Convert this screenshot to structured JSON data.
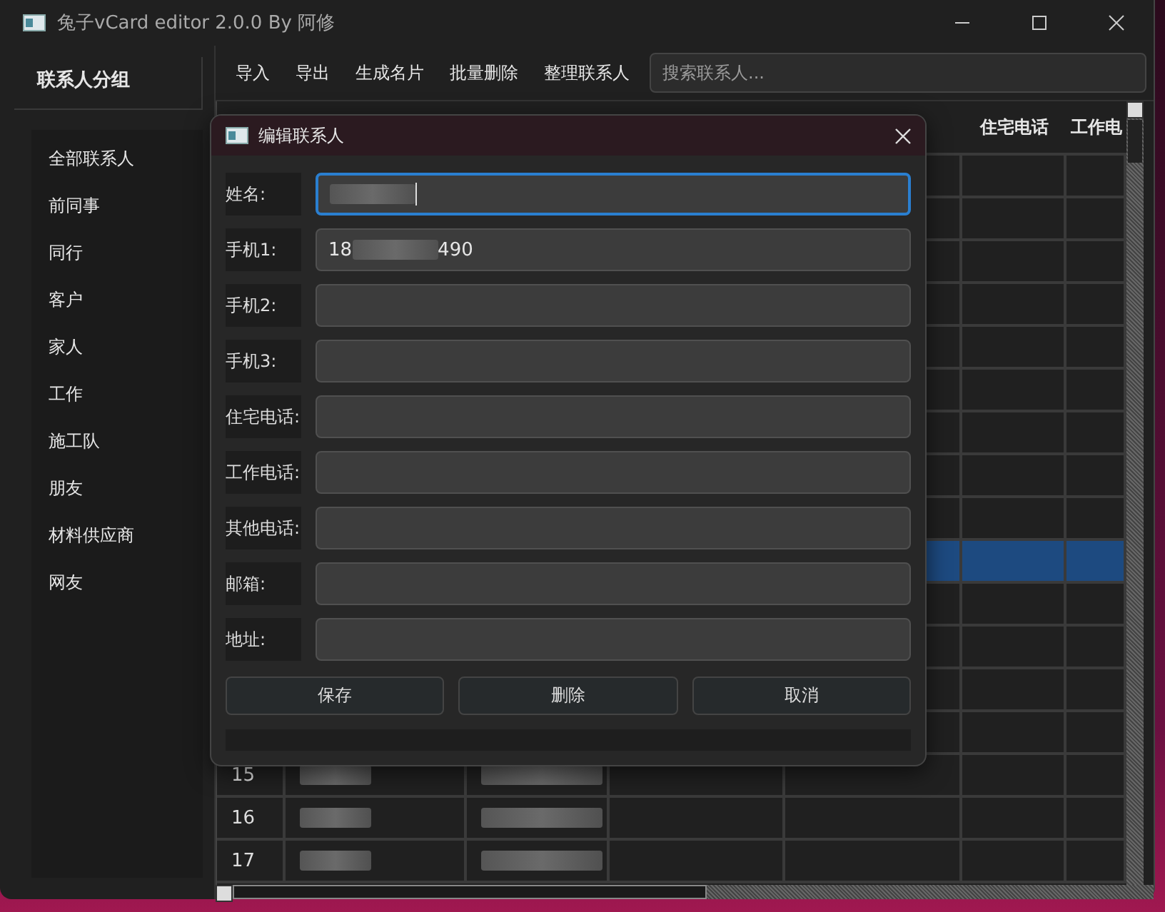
{
  "window": {
    "title": "兔子vCard editor 2.0.0 By 阿修"
  },
  "sidebar": {
    "title": "联系人分组",
    "items": [
      {
        "label": "全部联系人",
        "selected": false
      },
      {
        "label": "前同事",
        "selected": false
      },
      {
        "label": "同行",
        "selected": false
      },
      {
        "label": "客户",
        "selected": false
      },
      {
        "label": "家人",
        "selected": false
      },
      {
        "label": "工作",
        "selected": false
      },
      {
        "label": "施工队",
        "selected": false
      },
      {
        "label": "朋友",
        "selected": false
      },
      {
        "label": "材料供应商",
        "selected": false
      },
      {
        "label": "网友",
        "selected": false
      }
    ]
  },
  "toolbar": {
    "buttons": [
      "导入",
      "导出",
      "生成名片",
      "批量删除",
      "整理联系人"
    ],
    "search": {
      "placeholder": "搜索联系人..."
    }
  },
  "table": {
    "columns": [
      {},
      {},
      {},
      {},
      {},
      {
        "label": "住宅电话"
      },
      {
        "label": "工作电"
      }
    ],
    "rows": [
      {
        "selected": false
      },
      {
        "selected": false
      },
      {
        "selected": false
      },
      {
        "selected": false
      },
      {
        "selected": false
      },
      {
        "selected": false
      },
      {
        "selected": false
      },
      {
        "selected": false
      },
      {
        "selected": false
      },
      {
        "selected": true
      },
      {
        "selected": false
      },
      {
        "selected": false
      },
      {
        "selected": false
      },
      {
        "selected": false
      },
      {
        "selected": false,
        "number": "15",
        "blurred": true
      },
      {
        "selected": false,
        "number": "16",
        "blurred": true
      },
      {
        "selected": false,
        "number": "17",
        "blurred": true
      }
    ]
  },
  "dialog": {
    "title": "编辑联系人",
    "fields": [
      {
        "label": "姓名:",
        "focused": true,
        "blurred": true
      },
      {
        "label": "手机1:",
        "focused": false,
        "blurred": true,
        "value_start": "18",
        "value_end": "490"
      },
      {
        "label": "手机2:",
        "focused": false,
        "blurred": false
      },
      {
        "label": "手机3:",
        "focused": false,
        "blurred": false
      },
      {
        "label": "住宅电话:",
        "focused": false,
        "blurred": false
      },
      {
        "label": "工作电话:",
        "focused": false,
        "blurred": false
      },
      {
        "label": "其他电话:",
        "focused": false,
        "blurred": false
      },
      {
        "label": "邮箱:",
        "focused": false,
        "blurred": false
      },
      {
        "label": "地址:",
        "focused": false,
        "blurred": false
      }
    ],
    "buttons": [
      "保存",
      "删除",
      "取消"
    ]
  }
}
